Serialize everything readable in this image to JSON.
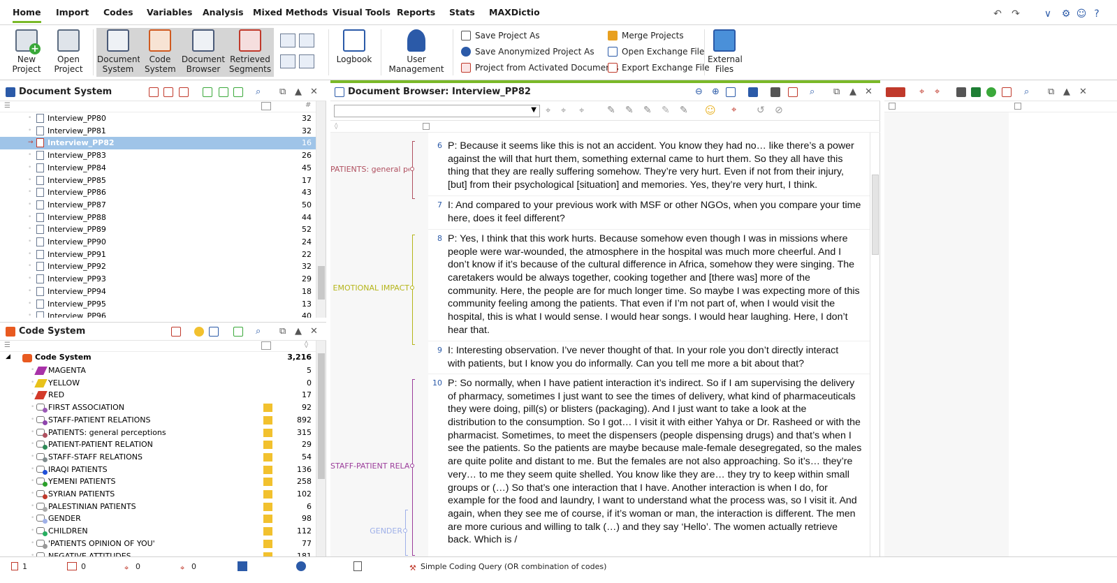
{
  "menu": {
    "items": [
      "Home",
      "Import",
      "Codes",
      "Variables",
      "Analysis",
      "Mixed Methods",
      "Visual Tools",
      "Reports",
      "Stats",
      "MAXDictio"
    ]
  },
  "ribbon": {
    "new_project": "New Project",
    "open_project": "Open Project",
    "document_system": "Document System",
    "code_system": "Code System",
    "document_browser": "Document Browser",
    "retrieved_segments": "Retrieved Segments",
    "logbook": "Logbook",
    "user_management": "User Management",
    "save_project_as": "Save Project As",
    "save_anonymized": "Save Anonymized Project As",
    "project_from_activated": "Project from Activated Documents",
    "merge_projects": "Merge Projects",
    "open_exchange": "Open Exchange File",
    "export_exchange": "Export Exchange File",
    "external_files": "External Files"
  },
  "document_system": {
    "title": "Document System",
    "column_hash": "#",
    "rows": [
      {
        "name": "Interview_PP80",
        "count": "32"
      },
      {
        "name": "Interview_PP81",
        "count": "32"
      },
      {
        "name": "Interview_PP82",
        "count": "16",
        "selected": true
      },
      {
        "name": "Interview_PP83",
        "count": "26"
      },
      {
        "name": "Interview_PP84",
        "count": "45"
      },
      {
        "name": "Interview_PP85",
        "count": "17"
      },
      {
        "name": "Interview_PP86",
        "count": "43"
      },
      {
        "name": "Interview_PP87",
        "count": "50"
      },
      {
        "name": "Interview_PP88",
        "count": "44"
      },
      {
        "name": "Interview_PP89",
        "count": "52"
      },
      {
        "name": "Interview_PP90",
        "count": "24"
      },
      {
        "name": "Interview_PP91",
        "count": "22"
      },
      {
        "name": "Interview_PP92",
        "count": "32"
      },
      {
        "name": "Interview_PP93",
        "count": "29"
      },
      {
        "name": "Interview_PP94",
        "count": "18"
      },
      {
        "name": "Interview_PP95",
        "count": "13"
      },
      {
        "name": "Interview_PP96",
        "count": "40"
      }
    ]
  },
  "code_system": {
    "title": "Code System",
    "root": {
      "name": "Code System",
      "count": "3,216"
    },
    "rows": [
      {
        "name": "MAGENTA",
        "count": "5",
        "color": "#a832a8",
        "type": "highlight",
        "memo": false
      },
      {
        "name": "YELLOW",
        "count": "0",
        "color": "#e8c21a",
        "type": "highlight",
        "memo": false
      },
      {
        "name": "RED",
        "count": "17",
        "color": "#d23a2a",
        "type": "highlight",
        "memo": false
      },
      {
        "name": "FIRST ASSOCIATION",
        "count": "92",
        "color": "#9b59b6",
        "type": "code",
        "memo": true
      },
      {
        "name": "STAFF-PATIENT RELATIONS",
        "count": "892",
        "color": "#8e44ad",
        "type": "code",
        "memo": true
      },
      {
        "name": "PATIENTS: general perceptions",
        "count": "315",
        "color": "#b05060",
        "type": "code",
        "memo": true
      },
      {
        "name": "PATIENT-PATIENT RELATION",
        "count": "29",
        "color": "#2e8b57",
        "type": "code",
        "memo": true
      },
      {
        "name": "STAFF-STAFF RELATIONS",
        "count": "54",
        "color": "#7f8c8d",
        "type": "code",
        "memo": true
      },
      {
        "name": "IRAQI PATIENTS",
        "count": "136",
        "color": "#1f4fd8",
        "type": "code",
        "memo": true
      },
      {
        "name": "YEMENI PATIENTS",
        "count": "258",
        "color": "#2aa02a",
        "type": "code",
        "memo": true
      },
      {
        "name": "SYRIAN PATIENTS",
        "count": "102",
        "color": "#c0392b",
        "type": "code",
        "memo": true
      },
      {
        "name": "PALESTINIAN PATIENTS",
        "count": "6",
        "color": "#aaaaaa",
        "type": "code",
        "memo": true
      },
      {
        "name": "GENDER",
        "count": "98",
        "color": "#9fb0e8",
        "type": "code",
        "memo": true
      },
      {
        "name": "CHILDREN",
        "count": "112",
        "color": "#27ae60",
        "type": "code",
        "memo": true
      },
      {
        "name": "'PATIENTS OPINION OF YOU'",
        "count": "77",
        "color": "#999999",
        "type": "code",
        "memo": true
      },
      {
        "name": "NEGATIVE ATTITUDES",
        "count": "181",
        "color": "#999999",
        "type": "code",
        "memo": true
      }
    ]
  },
  "document_browser": {
    "title": "Document Browser: Interview_PP82",
    "paragraphs": [
      {
        "num": "6",
        "lines": [
          "P: Because it seems like this is not an accident. You know they had no… like there’s a power",
          "against the will that hurt them, something external came to hurt them. So they all have this",
          "thing that they are really suffering somehow. They’re very hurt. Even if not from their injury,",
          "[but] from their psychological [situation] and memories. Yes, they’re very hurt, I think."
        ]
      },
      {
        "num": "7",
        "lines": [
          "I: And compared to your previous work with MSF or other NGOs, when you compare your time",
          "here, does it feel different?"
        ]
      },
      {
        "num": "8",
        "lines": [
          "P: Yes, I think that this work hurts. Because somehow even though I was in missions where",
          "people were war-wounded, the atmosphere in the hospital was much more cheerful. And I",
          "don’t know if it’s because of the cultural difference in Africa, somehow they were singing. The",
          "caretakers would be always together, cooking together and [there was] more of the",
          "community. Here, the people are for much longer time. So maybe I was expecting more of this",
          "community feeling among the patients. That even if I’m not part of, when I would visit the",
          "hospital, this is what I would sense. I would hear songs. I would hear laughing. Here, I don’t",
          "hear that."
        ]
      },
      {
        "num": "9",
        "lines": [
          "I: Interesting observation. I’ve never thought of that. In your role you don’t directly interact",
          "with patients, but I know you do informally. Can you tell me more a bit about that?"
        ]
      },
      {
        "num": "10",
        "lines": [
          "P: So normally, when I have patient interaction it’s indirect. So if I am supervising the delivery",
          "of pharmacy, sometimes I just want to see the times of delivery, what kind of pharmaceuticals",
          "they were doing, pill(s) or blisters (packaging). And I just want to take a look at the",
          "distribution to the consumption. So I got… I visit it with either Yahya or Dr. Rasheed or with the",
          "pharmacist. Sometimes, to meet the dispensers (people dispensing drugs) and that’s when I",
          "see the patients. So the patients are maybe because male-female desegregated, so the males",
          "are quite polite and distant to me. But the females are not also approaching. So it’s… they’re",
          "very… to me they seem quite shelled. You know like they are… they try to keep within small",
          "groups or (…) So that’s one interaction that I have. Another interaction is when I do, for",
          "example for the food and laundry, I want to understand what the process was, so I visit it. And",
          "again, when they see me of course, if it’s woman or man, the interaction is different. The men",
          "are more curious and willing to talk (…) and they say ‘Hello’. The women actually retrieve",
          "back. Which is /"
        ]
      }
    ],
    "code_stripes": [
      {
        "label": "PATIENTS: general per",
        "color": "#b05060"
      },
      {
        "label": "EMOTIONAL IMPACT",
        "color": "#b5b51a"
      },
      {
        "label": "STAFF-PATIENT RELATI",
        "color": "#9b3d9b"
      },
      {
        "label": "GENDER",
        "color": "#9fb0e8"
      }
    ]
  },
  "statusbar": {
    "docs": "1",
    "codes": "0",
    "coded_segments": "0",
    "activated": "0",
    "query": "Simple Coding Query (OR combination of codes)"
  }
}
